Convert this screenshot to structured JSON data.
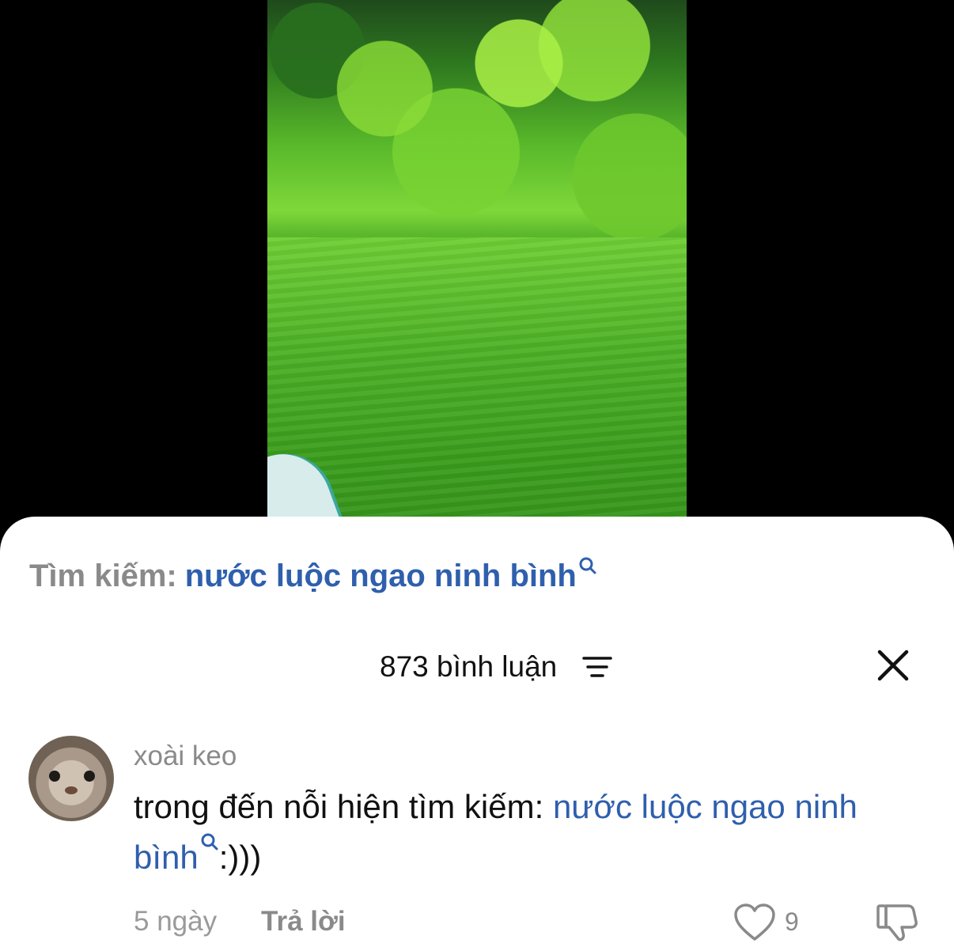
{
  "video": {
    "scene": "green-river-landscape"
  },
  "search_suggestion": {
    "prefix": "Tìm kiếm:",
    "query": "nước luộc ngao ninh bình",
    "icon": "search-icon"
  },
  "comments_header": {
    "count_label": "873 bình luận",
    "filter_icon": "filter-icon",
    "close_icon": "close-icon"
  },
  "comment": {
    "username": "xoài keo",
    "text_before": "trong đến nỗi hiện tìm kiếm: ",
    "link_text": "nước luộc ngao ninh bình",
    "text_after": ":)))",
    "time": "5 ngày",
    "reply_label": "Trả lời",
    "like_count": "9"
  },
  "colors": {
    "link": "#2f5fad",
    "muted": "#8a8a8a",
    "text": "#111111"
  }
}
